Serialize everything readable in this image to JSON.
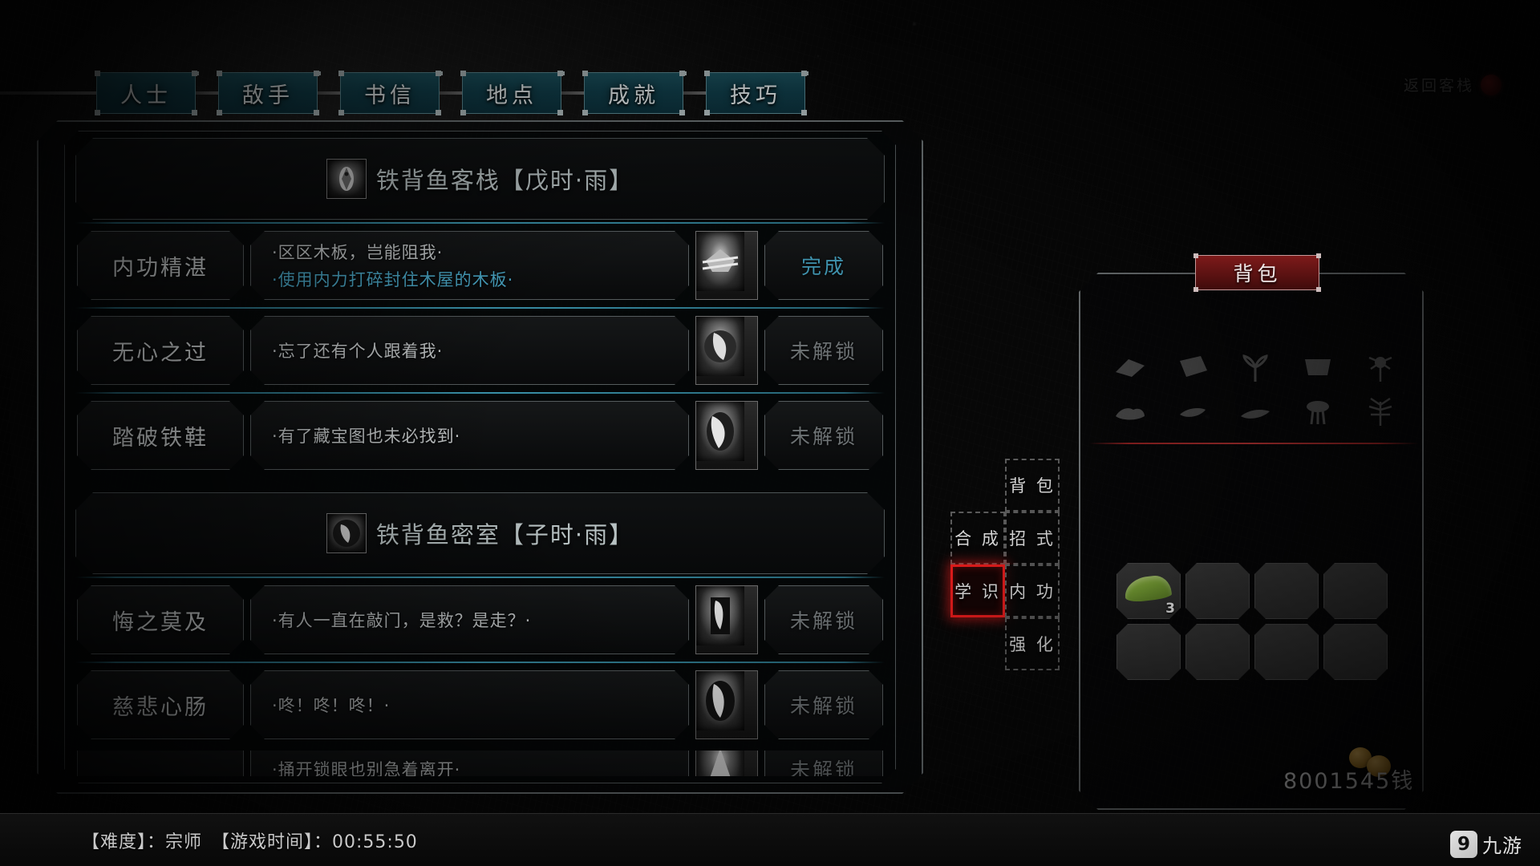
{
  "top_tabs": [
    {
      "label": "人士",
      "name": "tab-people"
    },
    {
      "label": "敌手",
      "name": "tab-enemies"
    },
    {
      "label": "书信",
      "name": "tab-letters"
    },
    {
      "label": "地点",
      "name": "tab-locations"
    },
    {
      "label": "成就",
      "name": "tab-achievements"
    },
    {
      "label": "技巧",
      "name": "tab-skills"
    }
  ],
  "return_link": {
    "label": "返回客栈"
  },
  "sections": [
    {
      "title": "铁背鱼客栈【戊时·雨】",
      "icon": "fish-crest-icon",
      "rows": [
        {
          "title": "内功精湛",
          "desc": "·区区木板，岂能阻我·",
          "hint": "·使用内力打碎封住木屋的木板·",
          "status": "完成",
          "state": "done",
          "icon": "broken-plank-icon"
        },
        {
          "title": "无心之过",
          "desc": "·忘了还有个人跟着我·",
          "hint": "",
          "status": "未解锁",
          "state": "locked",
          "icon": "follower-icon"
        },
        {
          "title": "踏破铁鞋",
          "desc": "·有了藏宝图也未必找到·",
          "hint": "",
          "status": "未解锁",
          "state": "locked",
          "icon": "treasure-map-icon"
        }
      ]
    },
    {
      "title": "铁背鱼密室【子时·雨】",
      "icon": "secret-room-icon",
      "rows": [
        {
          "title": "悔之莫及",
          "desc": "·有人一直在敲门，是救？是走？·",
          "hint": "",
          "status": "未解锁",
          "state": "locked",
          "icon": "knocking-door-icon"
        },
        {
          "title": "慈悲心肠",
          "desc": "·咚！咚！咚！·",
          "hint": "",
          "status": "未解锁",
          "state": "locked",
          "icon": "mercy-icon"
        },
        {
          "title": "",
          "desc": "·捅开锁眼也别急着离开·",
          "hint": "",
          "status": "未解锁",
          "state": "locked",
          "icon": "lockpick-icon"
        }
      ]
    }
  ],
  "inventory": {
    "banner": "背包",
    "silhouettes": [
      "cloth-scrap-icon",
      "wood-plank-icon",
      "grass-herb-icon",
      "hide-pelt-icon",
      "flower-icon",
      "ore-chunk-icon",
      "bone-shard-icon",
      "root-icon",
      "mushroom-icon",
      "fern-icon"
    ],
    "slots": [
      {
        "item": "green-gourd-icon",
        "qty": "3"
      },
      {
        "item": "",
        "qty": ""
      },
      {
        "item": "",
        "qty": ""
      },
      {
        "item": "",
        "qty": ""
      },
      {
        "item": "",
        "qty": ""
      },
      {
        "item": "",
        "qty": ""
      },
      {
        "item": "",
        "qty": ""
      },
      {
        "item": "",
        "qty": ""
      }
    ],
    "money": "8001545钱"
  },
  "menu": {
    "left": [
      {
        "label": "合 成",
        "name": "menu-craft",
        "selected": false
      },
      {
        "label": "学 识",
        "name": "menu-knowledge",
        "selected": true
      }
    ],
    "right": [
      {
        "label": "背 包",
        "name": "menu-backpack",
        "selected": false
      },
      {
        "label": "招 式",
        "name": "menu-moves",
        "selected": false
      },
      {
        "label": "内 功",
        "name": "menu-inner-power",
        "selected": false
      },
      {
        "label": "强 化",
        "name": "menu-enhance",
        "selected": false
      }
    ]
  },
  "statusbar": {
    "text": "【难度】：宗师　【游戏时间】：00:55:50"
  },
  "watermark": {
    "mark": "9",
    "text": "九游"
  },
  "colors": {
    "tab_fill": "#11414e",
    "accent_teal": "#3a93ab",
    "status_done": "#3f92ad",
    "status_locked": "#6d7274",
    "banner_red": "#5c1212",
    "selection_red": "#e01b1b",
    "hint_blue": "#49a5c4"
  }
}
